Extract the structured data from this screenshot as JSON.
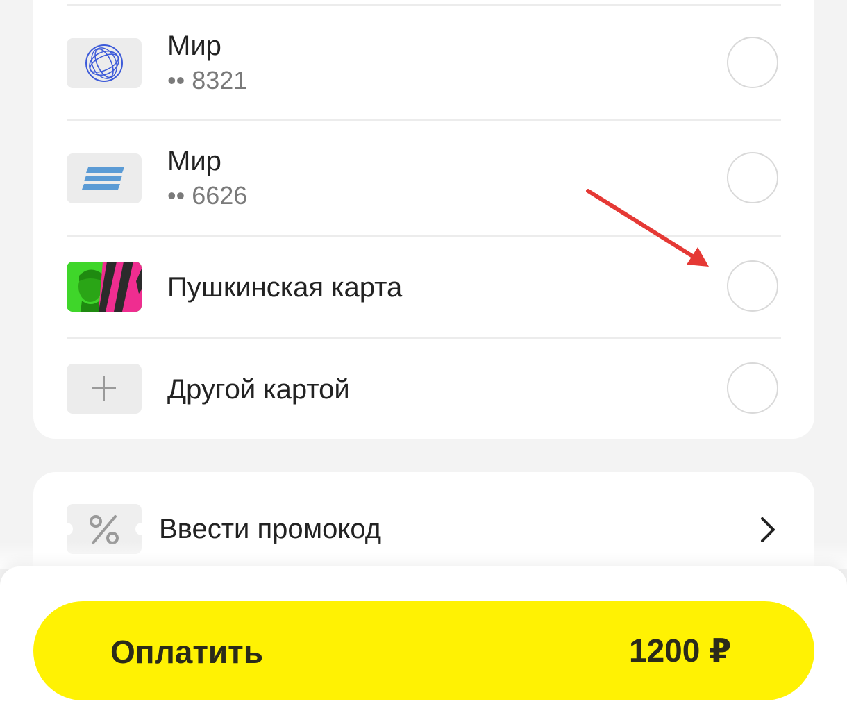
{
  "cards": [
    {
      "title": "Мир",
      "masked_number": "•• 8321",
      "icon": "gazprombank-logo-icon"
    },
    {
      "title": "Мир",
      "masked_number": "•• 6626",
      "icon": "sber-stripes-logo-icon"
    },
    {
      "title": "Пушкинская карта",
      "icon": "pushkin-card-icon"
    },
    {
      "title": "Другой картой",
      "icon": "plus-icon"
    }
  ],
  "promo": {
    "label": "Ввести промокод",
    "icon": "percent-icon",
    "chevron": "chevron-right-icon"
  },
  "pay": {
    "label": "Оплатить",
    "amount": "1200 ₽"
  },
  "colors": {
    "accent": "#fff203",
    "annotation_arrow": "#e53935",
    "card_stripes": "#5b9bd5"
  }
}
